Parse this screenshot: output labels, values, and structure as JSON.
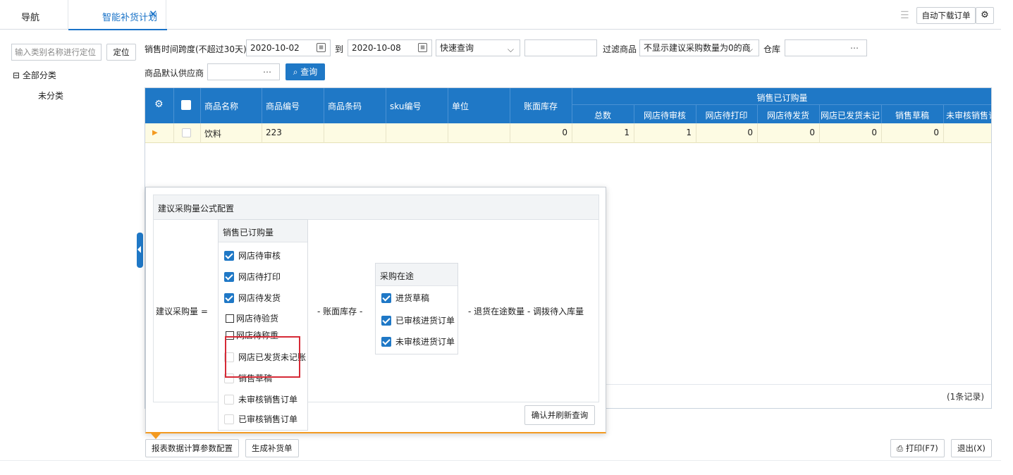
{
  "tabs": {
    "nav": "导航",
    "active": "智能补货计划",
    "close": "✕"
  },
  "toolbar": {
    "auto_download": "自动下载订单"
  },
  "left": {
    "search_placeholder": "输入类别名称进行定位",
    "locate": "定位",
    "root": "全部分类",
    "child": "未分类",
    "expander": "⊟"
  },
  "filters": {
    "period_label": "销售时间跨度(不超过30天)",
    "date_from": "2020-10-02",
    "to": "到",
    "date_to": "2020-10-08",
    "quick_query": "快速查询",
    "filter_label": "过滤商品",
    "filter_value": "不显示建议采购数量为0的商",
    "warehouse_label": "仓库",
    "supplier_label": "商品默认供应商",
    "query": "查询"
  },
  "grid": {
    "columns": [
      "商品名称",
      "商品编号",
      "商品条码",
      "sku编号",
      "单位",
      "账面库存"
    ],
    "group_header": "销售已订购量",
    "sub_columns": [
      "总数",
      "网店待审核",
      "网店待打印",
      "网店待发货",
      "网店已发货未记",
      "销售草稿",
      "未审核销售订"
    ],
    "row": {
      "name": "饮料",
      "code": "223",
      "barcode": "",
      "sku": "",
      "unit": "",
      "stock": "0",
      "total": "1",
      "pending_review": "1",
      "pending_print": "0",
      "pending_ship": "0",
      "shipped_unrecorded": "0",
      "sales_draft": "0",
      "unreviewed_order": ""
    },
    "records": "(1条记录)"
  },
  "popup": {
    "title": "建议采购量公式配置",
    "lhs": "建议采购量 =",
    "minus_stock": "-  账面库存  -",
    "tail": "- 退货在途数量  -  调拨待入库量",
    "sales_group": {
      "title": "销售已订购量",
      "items": [
        {
          "label": "网店待审核",
          "checked": true
        },
        {
          "label": "网店待打印",
          "checked": true
        },
        {
          "label": "网店待发货",
          "checked": true
        },
        {
          "label": "网店待验货",
          "checked": false
        },
        {
          "label": "网店待称重",
          "checked": false
        },
        {
          "label": "网店已发货未记账",
          "checked": false
        },
        {
          "label": "销售草稿",
          "checked": false
        },
        {
          "label": "未审核销售订单",
          "checked": false
        },
        {
          "label": "已审核销售订单",
          "checked": false
        }
      ]
    },
    "purchase_group": {
      "title": "采购在途",
      "items": [
        {
          "label": "进货草稿",
          "checked": true
        },
        {
          "label": "已审核进货订单",
          "checked": true
        },
        {
          "label": "未审核进货订单",
          "checked": true
        }
      ]
    },
    "confirm": "确认并刷新查询"
  },
  "bottom": {
    "config": "报表数据计算参数配置",
    "generate": "生成补货单",
    "print": "打印(F7)",
    "exit": "退出(X)"
  }
}
